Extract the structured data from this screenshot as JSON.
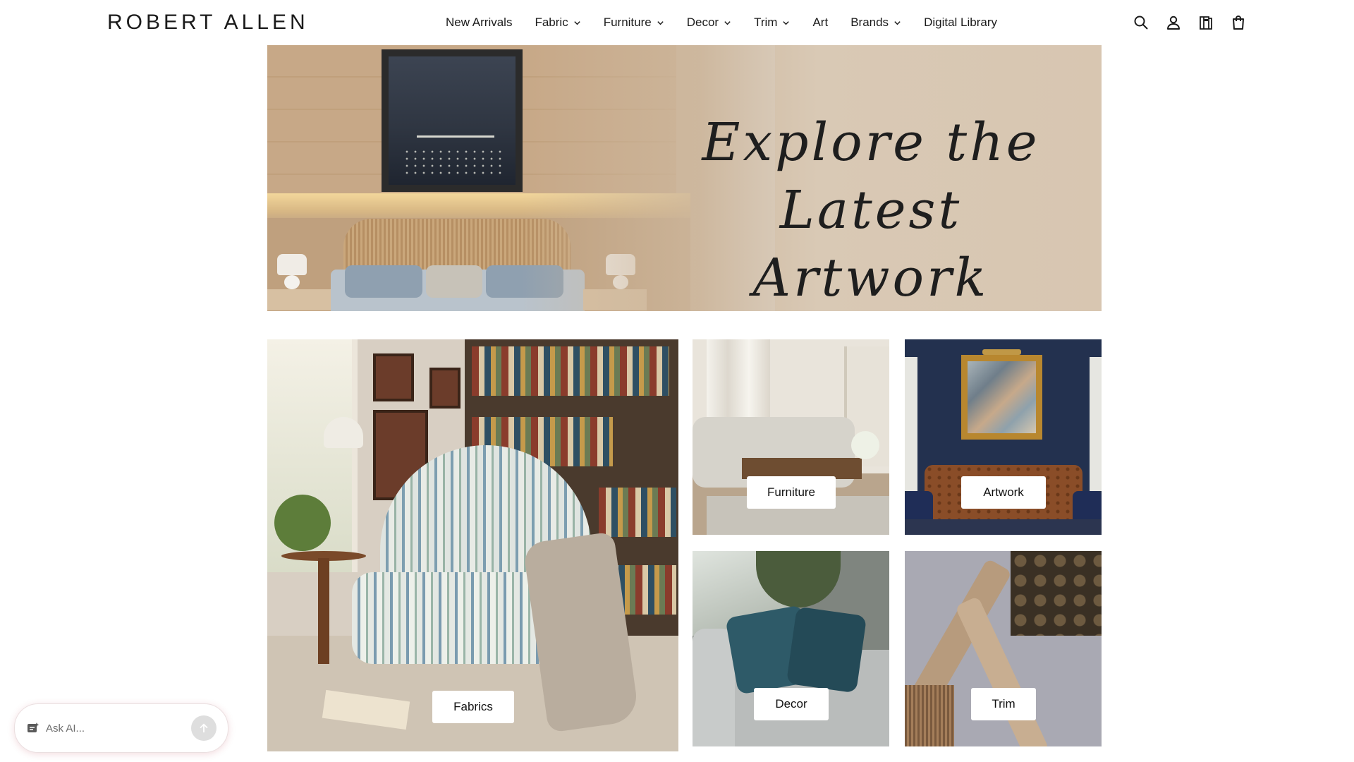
{
  "header": {
    "logo": "ROBERT ALLEN",
    "nav": [
      {
        "label": "New Arrivals",
        "dropdown": false
      },
      {
        "label": "Fabric",
        "dropdown": true
      },
      {
        "label": "Furniture",
        "dropdown": true
      },
      {
        "label": "Decor",
        "dropdown": true
      },
      {
        "label": "Trim",
        "dropdown": true
      },
      {
        "label": "Art",
        "dropdown": false
      },
      {
        "label": "Brands",
        "dropdown": true
      },
      {
        "label": "Digital Library",
        "dropdown": false
      }
    ],
    "icons": [
      "search-icon",
      "account-icon",
      "samples-book-icon",
      "shopping-bag-icon"
    ]
  },
  "hero": {
    "line1": "Explore the Latest",
    "line2": "Artwork Collection"
  },
  "categories": {
    "fabrics": "Fabrics",
    "furniture": "Furniture",
    "artwork": "Artwork",
    "decor": "Decor",
    "trim": "Trim"
  },
  "ask_ai": {
    "placeholder": "Ask AI...",
    "icons": [
      "ai-sparkle-icon",
      "send-arrow-icon"
    ]
  },
  "colors": {
    "text": "#1b1b1b",
    "background": "#ffffff",
    "ask_border_glow": "#d9707f"
  }
}
